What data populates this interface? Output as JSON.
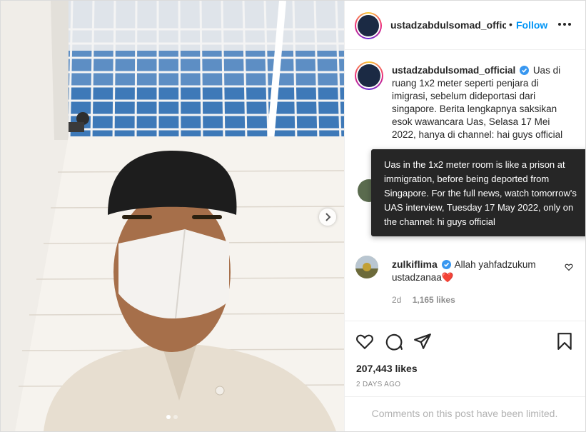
{
  "post": {
    "author": "ustadzabdulsomad_official",
    "author_truncated": "ustadzabdulsomad_officia",
    "follow_label": "Follow",
    "separator": "•",
    "caption": "Uas di ruang 1x2 meter seperti penjara di imigrasi, sebelum dideportasi dari singapore. Berita lengkapnya saksikan esok wawancara Uas, Selasa 17 Mei 2022, hanya di channel: hai guys official",
    "likes": "207,443 likes",
    "date": "2 DAYS AGO",
    "comments_limited": "Comments on this post have been limited.",
    "carousel": {
      "current": 1,
      "total": 2
    }
  },
  "tooltip": {
    "text": "Uas in the 1x2 meter room is like a prison at immigration, before being deported from Singapore. For the full news, watch tomorrow's UAS interview, Tuesday 17 May 2022, only on the channel: hi guys official"
  },
  "comments": [
    {
      "user": "zulkiflima",
      "text": "Allah yahfadzukum ustadzanaa",
      "emoji": "❤️",
      "age": "2d",
      "likes": "1,165 likes"
    }
  ],
  "icons": [
    "more-icon",
    "verified-icon",
    "heart-icon",
    "comment-icon",
    "share-icon",
    "bookmark-icon",
    "chevron-right-icon"
  ],
  "colors": {
    "accent": "#0095f6",
    "verified": "#3897f0",
    "text": "#262626",
    "muted": "#8e8e8e",
    "tooltip_bg": "#262626"
  }
}
